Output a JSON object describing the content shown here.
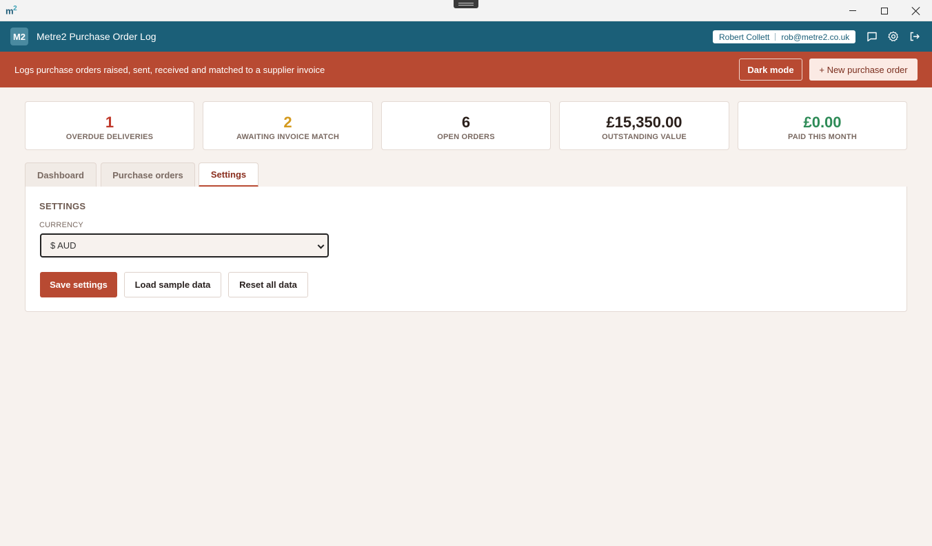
{
  "window": {
    "logo": "m",
    "logo_sup": "2"
  },
  "header": {
    "logo": "M2",
    "title": "Metre2 Purchase Order Log",
    "user_name": "Robert Collett",
    "user_email": "rob@metre2.co.uk",
    "icons": [
      "message-icon",
      "gear-icon",
      "logout-icon"
    ]
  },
  "banner": {
    "text": "Logs purchase orders raised, sent, received and matched to a supplier invoice",
    "dark_mode_label": "Dark mode",
    "new_order_label": "+ New purchase order"
  },
  "stats": [
    {
      "value": "1",
      "label": "OVERDUE DELIVERIES",
      "color": "#c0392b"
    },
    {
      "value": "2",
      "label": "AWAITING INVOICE MATCH",
      "color": "#d49a1e"
    },
    {
      "value": "6",
      "label": "OPEN ORDERS",
      "color": "#2a1f1a"
    },
    {
      "value": "£15,350.00",
      "label": "OUTSTANDING VALUE",
      "color": "#2a1f1a"
    },
    {
      "value": "£0.00",
      "label": "PAID THIS MONTH",
      "color": "#2e8b57"
    }
  ],
  "tabs": [
    {
      "label": "Dashboard",
      "active": false
    },
    {
      "label": "Purchase orders",
      "active": false
    },
    {
      "label": "Settings",
      "active": true
    }
  ],
  "settings": {
    "title": "SETTINGS",
    "currency_label": "CURRENCY",
    "currency_value": "$ AUD",
    "save_label": "Save settings",
    "load_label": "Load sample data",
    "reset_label": "Reset all data"
  },
  "colors": {
    "header": "#1b5f78",
    "banner": "#b84a32",
    "background": "#f7f2ee"
  }
}
